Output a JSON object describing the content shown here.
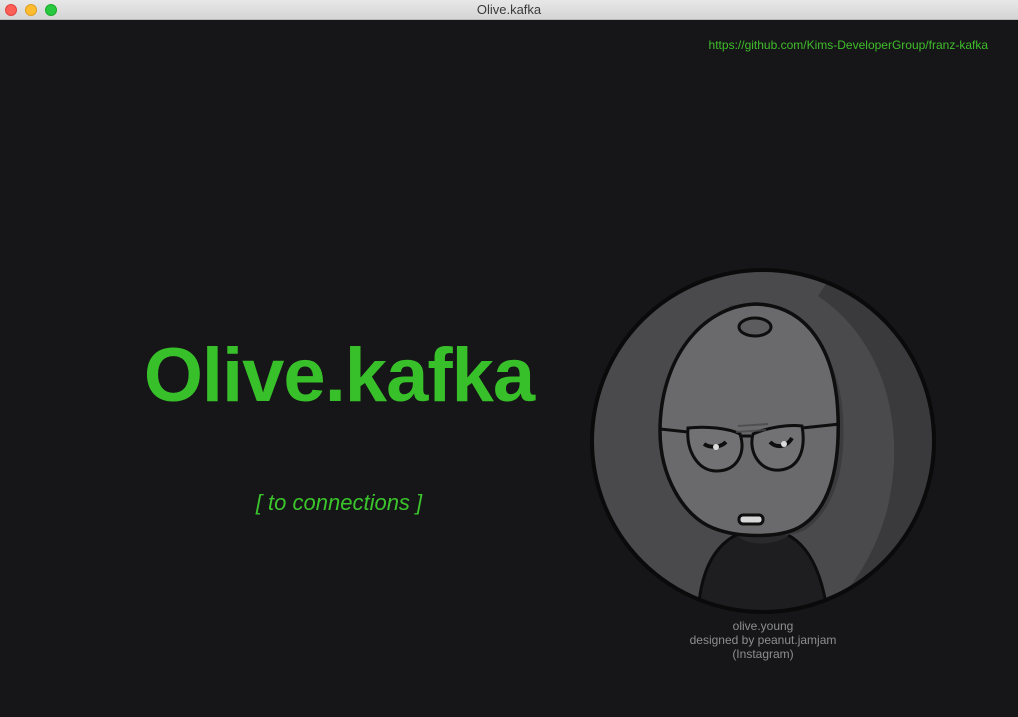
{
  "window": {
    "title": "Olive.kafka"
  },
  "header": {
    "repo_link": "https://github.com/Kims-DeveloperGroup/franz-kafka"
  },
  "main": {
    "brand": "Olive.kafka",
    "connections_link": "[ to connections ]"
  },
  "avatar": {
    "credit_name": "olive.young",
    "credit_designer": "designed by peanut.jamjam",
    "credit_platform": "(Instagram)"
  },
  "colors": {
    "background": "#161618",
    "accent_green": "#38c02a",
    "credit_gray": "#8d8e92"
  }
}
